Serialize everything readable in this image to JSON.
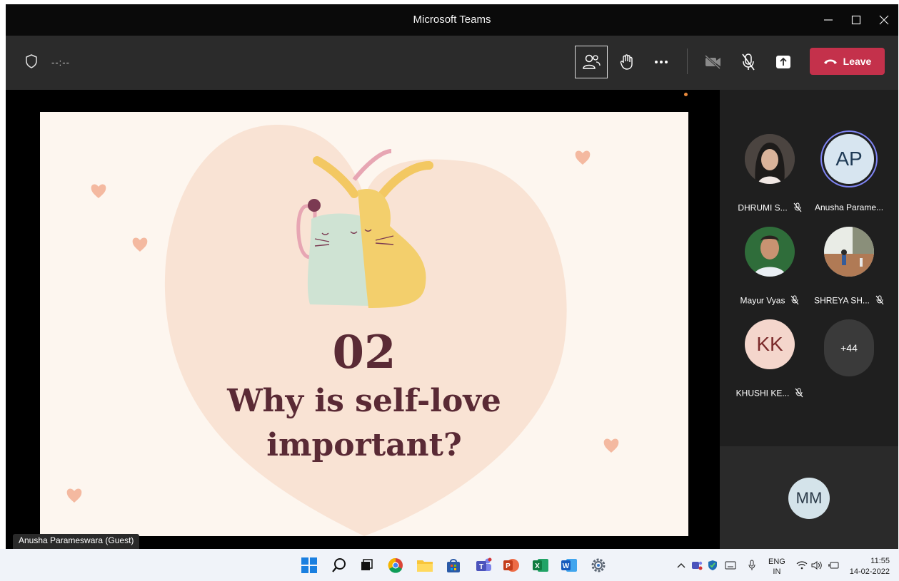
{
  "window": {
    "title": "Microsoft Teams"
  },
  "toolbar": {
    "timer": "--:--",
    "leave_label": "Leave"
  },
  "slide": {
    "number": "02",
    "title_line1": "Why is self-love",
    "title_line2": "important?"
  },
  "presenter_label": "Anusha Parameswara (Guest)",
  "participants": [
    {
      "name": "DHRUMI S...",
      "muted": true
    },
    {
      "name": "Anusha Parame...",
      "initials": "AP",
      "muted": false
    },
    {
      "name": "Mayur Vyas",
      "muted": true
    },
    {
      "name": "SHREYA SH...",
      "muted": true
    },
    {
      "name": "KHUSHI KE...",
      "initials": "KK",
      "muted": true
    }
  ],
  "more_participants": "+44",
  "self_view": {
    "initials": "MM"
  },
  "taskbar": {
    "lang_line1": "ENG",
    "lang_line2": "IN",
    "time": "11:55",
    "date": "14-02-2022"
  },
  "colors": {
    "leave": "#c4314b",
    "slide_text": "#5a2a35",
    "slide_bg": "#fdf6ef",
    "heart": "#f7dccb",
    "accent_ring": "#7f85f5"
  }
}
